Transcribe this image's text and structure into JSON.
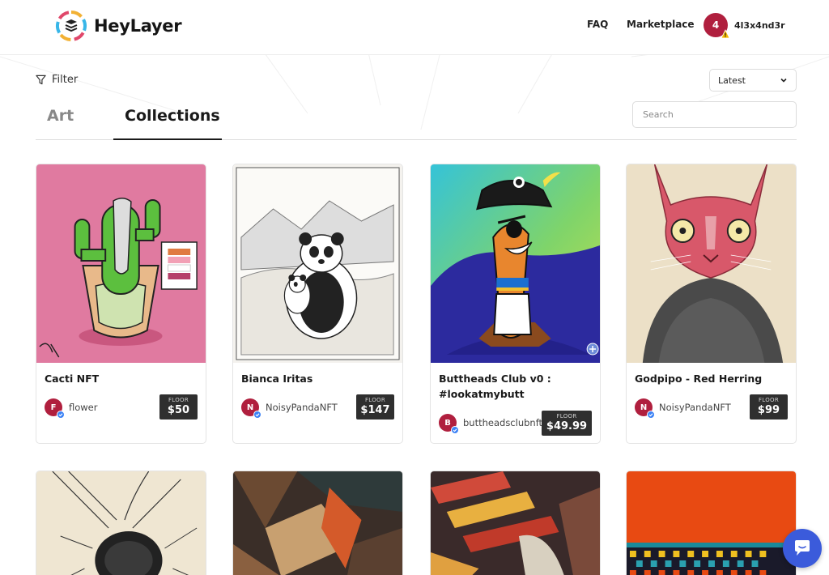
{
  "app": {
    "name": "HeyLayer"
  },
  "nav": {
    "faq": "FAQ",
    "marketplace": "Marketplace"
  },
  "user": {
    "initial": "4",
    "name": "4l3x4nd3r"
  },
  "toolbar": {
    "filter_label": "Filter",
    "sort_selected": "Latest",
    "search_placeholder": "Search"
  },
  "tabs": [
    {
      "label": "Art",
      "active": false
    },
    {
      "label": "Collections",
      "active": true
    }
  ],
  "cards": [
    {
      "title": "Cacti NFT",
      "creator": "flower",
      "creator_initial": "F",
      "floor_label": "FLOOR",
      "floor_price": "$50"
    },
    {
      "title": "Bianca Iritas",
      "creator": "NoisyPandaNFT",
      "creator_initial": "N",
      "floor_label": "FLOOR",
      "floor_price": "$147"
    },
    {
      "title": "Buttheads Club v0 : #lookatmybutt",
      "creator": "buttheadsclubnft",
      "creator_initial": "B",
      "floor_label": "FLOOR",
      "floor_price": "$49.99"
    },
    {
      "title": "Godpipo - Red Herring",
      "creator": "NoisyPandaNFT",
      "creator_initial": "N",
      "floor_label": "FLOOR",
      "floor_price": "$99"
    }
  ],
  "colors": {
    "accent": "#b01f3e",
    "floor_badge": "#2f2f2f",
    "chat": "#3b5bdb"
  },
  "icons": {
    "filter": "filter-icon",
    "sort": "chevron-down-icon",
    "verified": "verified-badge-icon",
    "chat": "chat-bubble-icon",
    "warning": "warning-icon"
  }
}
